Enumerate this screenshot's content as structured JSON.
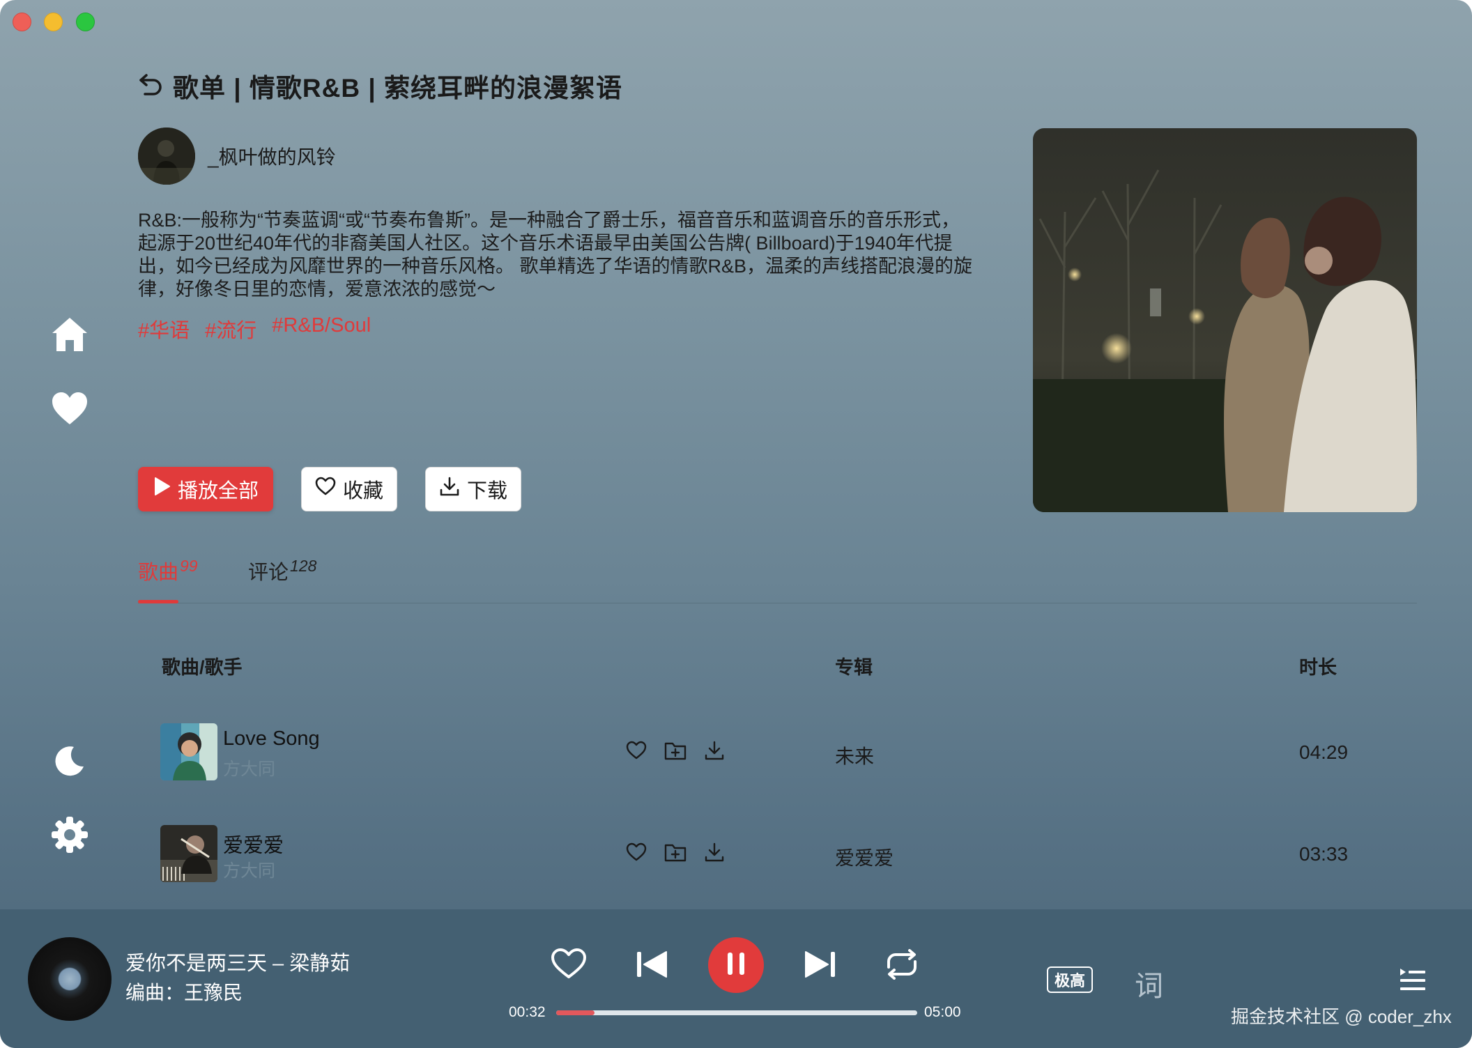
{
  "header": {
    "title": "歌单 | 情歌R&B | 萦绕耳畔的浪漫絮语"
  },
  "creator": {
    "name": "_枫叶做的风铃"
  },
  "description": "R&B:一般称为“节奏蓝调“或“节奏布鲁斯”。是一种融合了爵士乐，福音音乐和蓝调音乐的音乐形式，起源于20世纪40年代的非裔美国人社区。这个音乐术语最早由美国公告牌( Billboard)于1940年代提出，如今已经成为风靡世界的一种音乐风格。 歌单精选了华语的情歌R&B，温柔的声线搭配浪漫的旋律，好像冬日里的恋情，爱意浓浓的感觉～",
  "tags": [
    "#华语",
    "#流行",
    "#R&B/Soul"
  ],
  "actions": {
    "play_all": "播放全部",
    "collect": "收藏",
    "download": "下载"
  },
  "tabs": [
    {
      "label": "歌曲",
      "count": "99"
    },
    {
      "label": "评论",
      "count": "128"
    }
  ],
  "table": {
    "headers": {
      "song": "歌曲/歌手",
      "album": "专辑",
      "duration": "时长"
    },
    "rows": [
      {
        "title": "Love Song",
        "artist": "方大同",
        "album": "未来",
        "duration": "04:29"
      },
      {
        "title": "爱爱爱",
        "artist": "方大同",
        "album": "爱爱爱",
        "duration": "03:33"
      }
    ]
  },
  "player": {
    "title": "爱你不是两三天 – 梁静茹",
    "subtitle": "编曲：王豫民",
    "current_time": "00:32",
    "total_time": "05:00",
    "progress": 0.107,
    "quality": "极高",
    "lyric_label": "词",
    "watermark": "掘金技术社区 @ coder_zhx"
  },
  "colors": {
    "accent": "#e13b3b",
    "player_bar": "#446072"
  },
  "icons": {
    "nav": [
      "home-icon",
      "heart-icon",
      "moon-icon",
      "gear-icon"
    ],
    "row": [
      "heart-outline-icon",
      "add-folder-icon",
      "download-icon"
    ],
    "player": [
      "heart-outline-icon",
      "skip-previous-icon",
      "pause-icon",
      "skip-next-icon",
      "repeat-icon",
      "playlist-icon"
    ]
  }
}
